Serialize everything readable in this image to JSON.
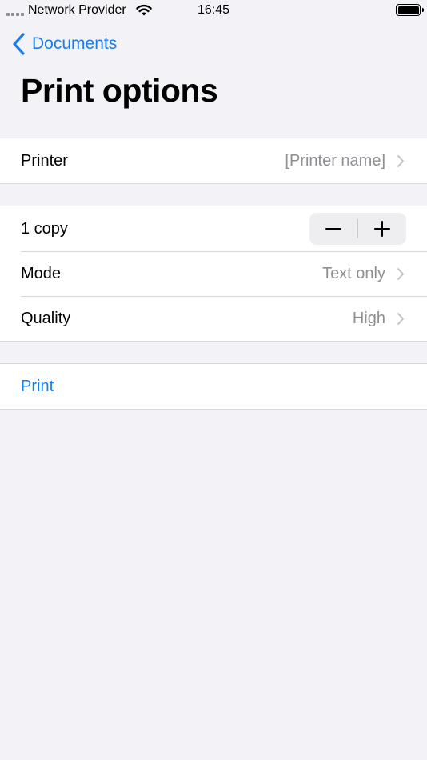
{
  "status_bar": {
    "carrier": "Network Provider",
    "time": "16:45"
  },
  "nav": {
    "back_label": "Documents"
  },
  "page": {
    "title": "Print options"
  },
  "printer_group": {
    "label": "Printer",
    "value": "[Printer name]"
  },
  "settings_group": {
    "copies_label": "1 copy",
    "mode_label": "Mode",
    "mode_value": "Text only",
    "quality_label": "Quality",
    "quality_value": "High"
  },
  "action_group": {
    "print_label": "Print"
  },
  "colors": {
    "accent": "#1a7ee8",
    "background": "#f2f2f7",
    "secondary_text": "#8e8e93",
    "separator": "#d8d8dc"
  },
  "icons": [
    "wifi-icon",
    "battery-icon",
    "chevron-left-icon",
    "chevron-right-icon",
    "minus-icon",
    "plus-icon"
  ]
}
